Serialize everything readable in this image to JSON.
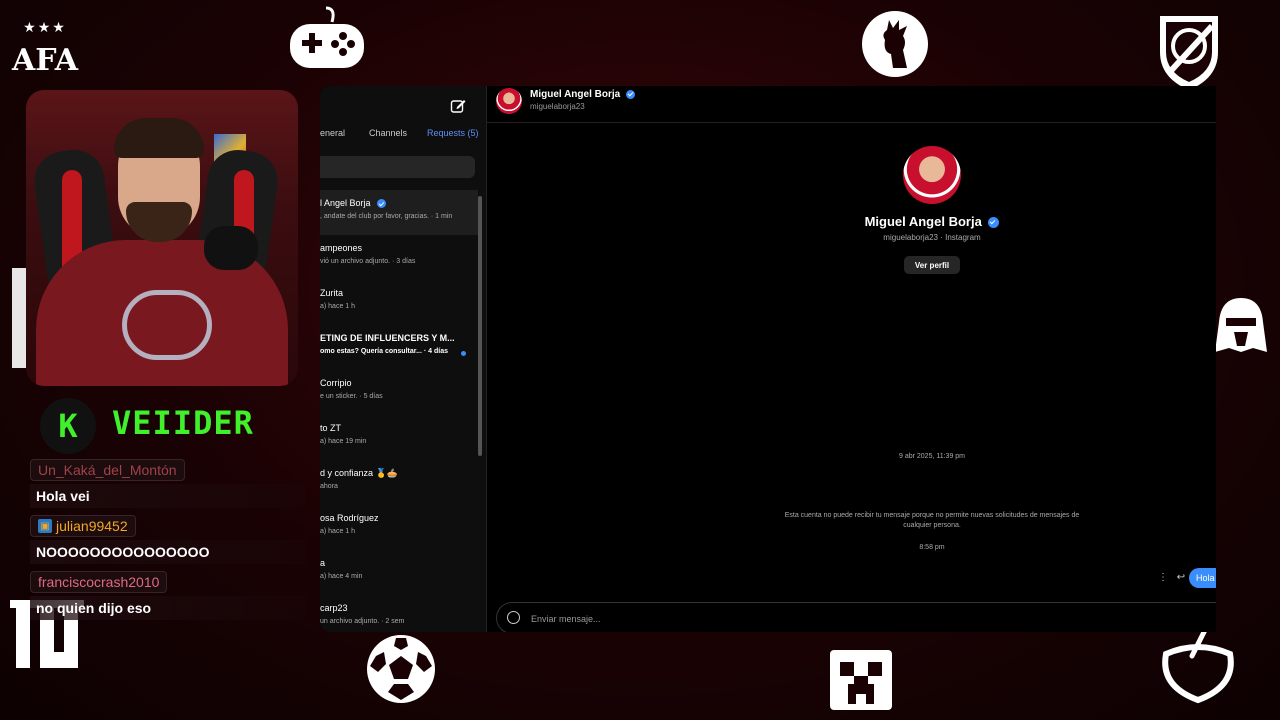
{
  "overlay": {
    "afa_logo": "AFA",
    "brand_letter": "K",
    "brand_name": "VEIIDER"
  },
  "chat": [
    {
      "user": "Un_Kaká_del_Montón",
      "user_color": "#a0424a",
      "badge": false,
      "message": "Hola vei"
    },
    {
      "user": "julian99452",
      "user_color": "#f5a623",
      "badge": true,
      "message": "NOOOOOOOOOOOOOOO"
    },
    {
      "user": "franciscocrash2010",
      "user_color": "#e06a80",
      "badge": false,
      "message": "no quien dijo eso"
    }
  ],
  "instagram": {
    "tabs": [
      "eneral",
      "Channels",
      "Requests (5)"
    ],
    "active_tab": "Requests (5)",
    "conversations": [
      {
        "name": "l Angel Borja",
        "verified": true,
        "preview": ", andate del club por favor, gracias. · 1 min",
        "active": true,
        "unread": false,
        "bold": false
      },
      {
        "name": "ampeones",
        "verified": false,
        "preview": "vió un archivo adjunto. · 3 días",
        "active": false,
        "unread": false,
        "bold": false
      },
      {
        "name": "Zurita",
        "verified": false,
        "preview": "a) hace 1 h",
        "active": false,
        "unread": false,
        "bold": false
      },
      {
        "name": "ETING DE INFLUENCERS Y M...",
        "verified": false,
        "preview": "omo estas? Quería consultar... · 4 días",
        "active": false,
        "unread": true,
        "bold": true
      },
      {
        "name": "Corripio",
        "verified": false,
        "preview": "e un sticker. · 5 días",
        "active": false,
        "unread": false,
        "bold": false
      },
      {
        "name": "to ZT",
        "verified": false,
        "preview": "a) hace 19 min",
        "active": false,
        "unread": false,
        "bold": false
      },
      {
        "name": "d y confianza 🥇🥧",
        "verified": false,
        "preview": "ahora",
        "active": false,
        "unread": false,
        "bold": false
      },
      {
        "name": "osa Rodríguez",
        "verified": false,
        "preview": "a) hace 1 h",
        "active": false,
        "unread": false,
        "bold": false
      },
      {
        "name": "a",
        "verified": false,
        "preview": "a) hace 4 min",
        "active": false,
        "unread": false,
        "bold": false
      },
      {
        "name": "carp23",
        "verified": false,
        "preview": "un archivo adjunto. · 2 sem",
        "active": false,
        "unread": false,
        "bold": false
      }
    ],
    "header": {
      "name": "Miguel Angel Borja",
      "username": "miguelaborja23"
    },
    "profile": {
      "name": "Miguel Angel Borja",
      "subtitle": "miguelaborja23 · Instagram",
      "button": "Ver perfil"
    },
    "timestamp": "9 abr 2025, 11:39 pm",
    "notice": "Esta cuenta no puede recibir tu mensaje porque no permite nuevas solicitudes de mensajes de cualquier persona.",
    "time2": "8:58 pm",
    "sent_message": "Hola",
    "composer_placeholder": "Enviar mensaje..."
  },
  "colors": {
    "accent_blue": "#3a8dfc",
    "brand_green": "#3ff02a",
    "background_red": "#3a0609"
  }
}
